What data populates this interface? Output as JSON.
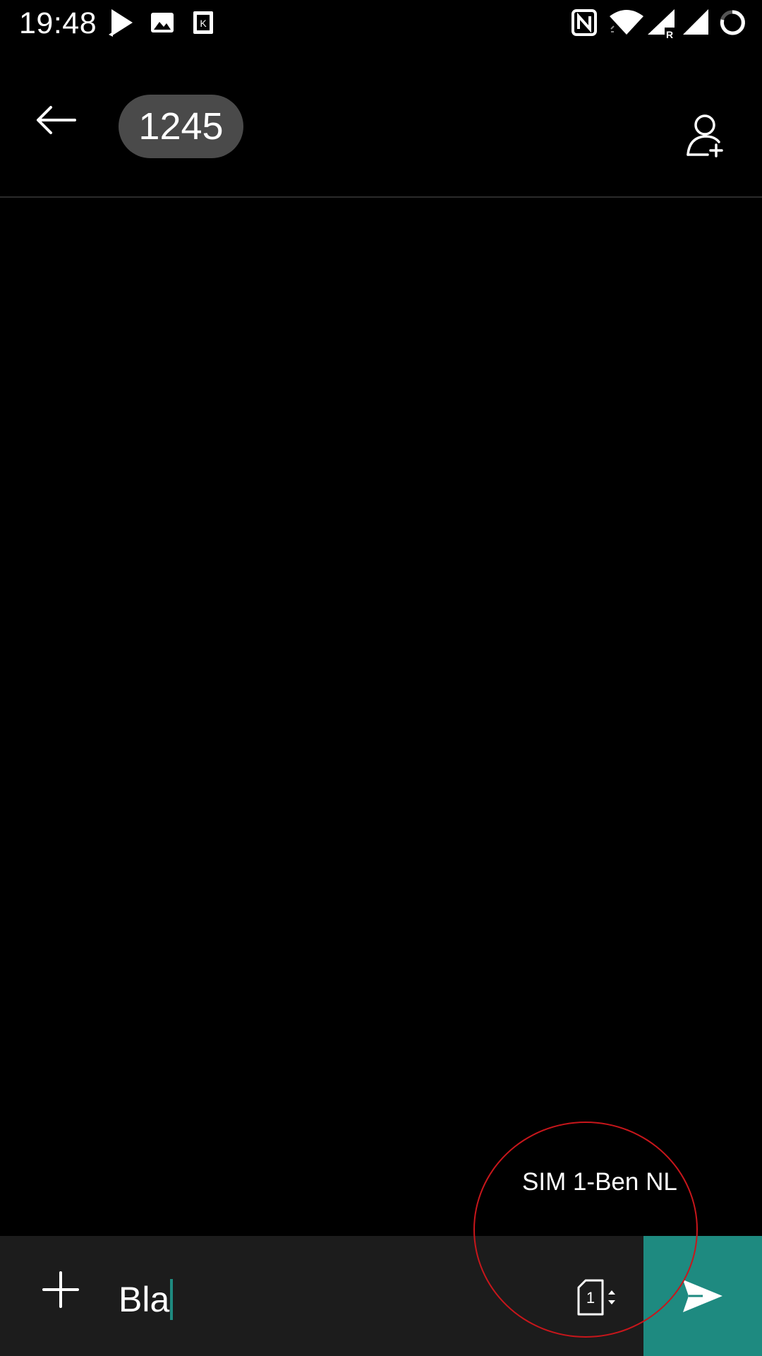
{
  "status_bar": {
    "time": "19:48",
    "left_icons": [
      "play-store-icon",
      "image-icon",
      "k-app-icon"
    ],
    "right_icons": [
      "nfc-icon",
      "wifi-icon",
      "signal-roaming-icon",
      "signal-icon",
      "battery-ring-icon"
    ]
  },
  "header": {
    "recipient": "1245",
    "back_icon": "arrow-left-icon",
    "add_contact_icon": "add-person-icon"
  },
  "conversation": {
    "sim_label": "SIM 1-Ben NL"
  },
  "compose": {
    "attach_icon": "plus-icon",
    "message_text": "Bla",
    "sim_switch_number": "1",
    "send_icon": "send-icon"
  },
  "colors": {
    "background": "#000000",
    "chip": "#4a4a4a",
    "compose_bar": "#1c1c1c",
    "accent": "#1e8a80",
    "annotation": "#c8161b"
  }
}
